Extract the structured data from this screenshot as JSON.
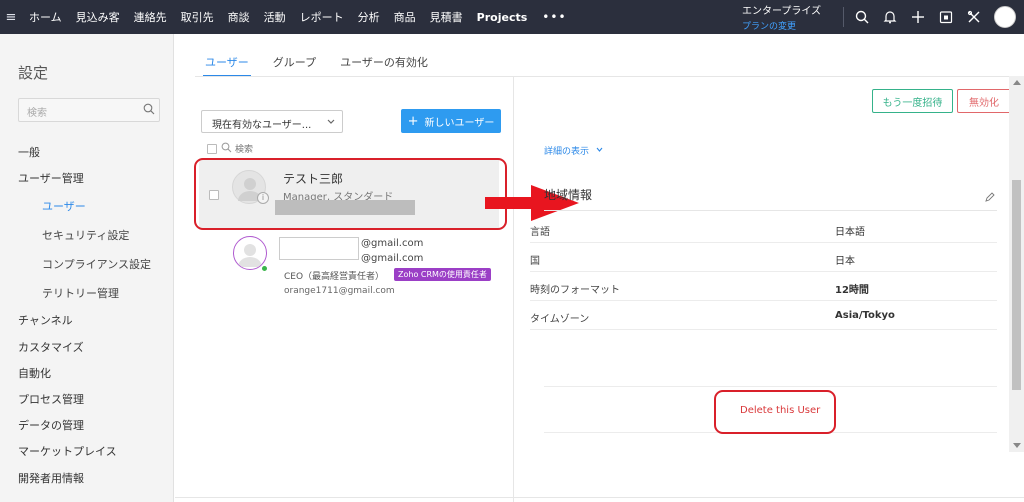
{
  "topnav": {
    "items": [
      "ホーム",
      "見込み客",
      "連絡先",
      "取引先",
      "商談",
      "活動",
      "レポート",
      "分析",
      "商品",
      "見積書",
      "Projects"
    ],
    "more": "•••",
    "edition_name": "エンタープライズ",
    "edition_link": "プランの変更"
  },
  "sidebar": {
    "title": "設定",
    "search_placeholder": "検索",
    "items": [
      {
        "label": "一般"
      },
      {
        "label": "ユーザー管理"
      },
      {
        "label": "ユーザー"
      },
      {
        "label": "セキュリティ設定"
      },
      {
        "label": "コンプライアンス設定"
      },
      {
        "label": "テリトリー管理"
      },
      {
        "label": "チャンネル"
      },
      {
        "label": "カスタマイズ"
      },
      {
        "label": "自動化"
      },
      {
        "label": "プロセス管理"
      },
      {
        "label": "データの管理"
      },
      {
        "label": "マーケットプレイス"
      },
      {
        "label": "開発者用情報"
      }
    ]
  },
  "tabs": [
    "ユーザー",
    "グループ",
    "ユーザーの有効化"
  ],
  "userlist": {
    "filter_label": "現在有効なユーザー...",
    "new_user_label": "新しいユーザー",
    "search_label": "検索",
    "user1": {
      "name": "テスト三郎",
      "role": "Manager, スタンダード"
    },
    "user2": {
      "email_line1": "@gmail.com",
      "email_line2": "@gmail.com",
      "role": "CEO（最高経営責任者）",
      "badge": "Zoho CRMの使用責任者",
      "email": "orange1711@gmail.com"
    }
  },
  "detail": {
    "reinvite_label": "もう一度招待",
    "deactivate_label": "無効化",
    "show_details": "詳細の表示",
    "section_title": "地域情報",
    "rows": [
      {
        "key": "言語",
        "value": "日本語"
      },
      {
        "key": "国",
        "value": "日本"
      },
      {
        "key": "時刻のフォーマット",
        "value": "12時間"
      },
      {
        "key": "タイムゾーン",
        "value": "Asia/Tokyo"
      }
    ],
    "delete_label": "Delete this User"
  },
  "colors": {
    "nav_bg": "#2b2f3d",
    "accent": "#2c89e8",
    "highlight_red": "#d9202a",
    "badge": "#9b3fc6"
  }
}
